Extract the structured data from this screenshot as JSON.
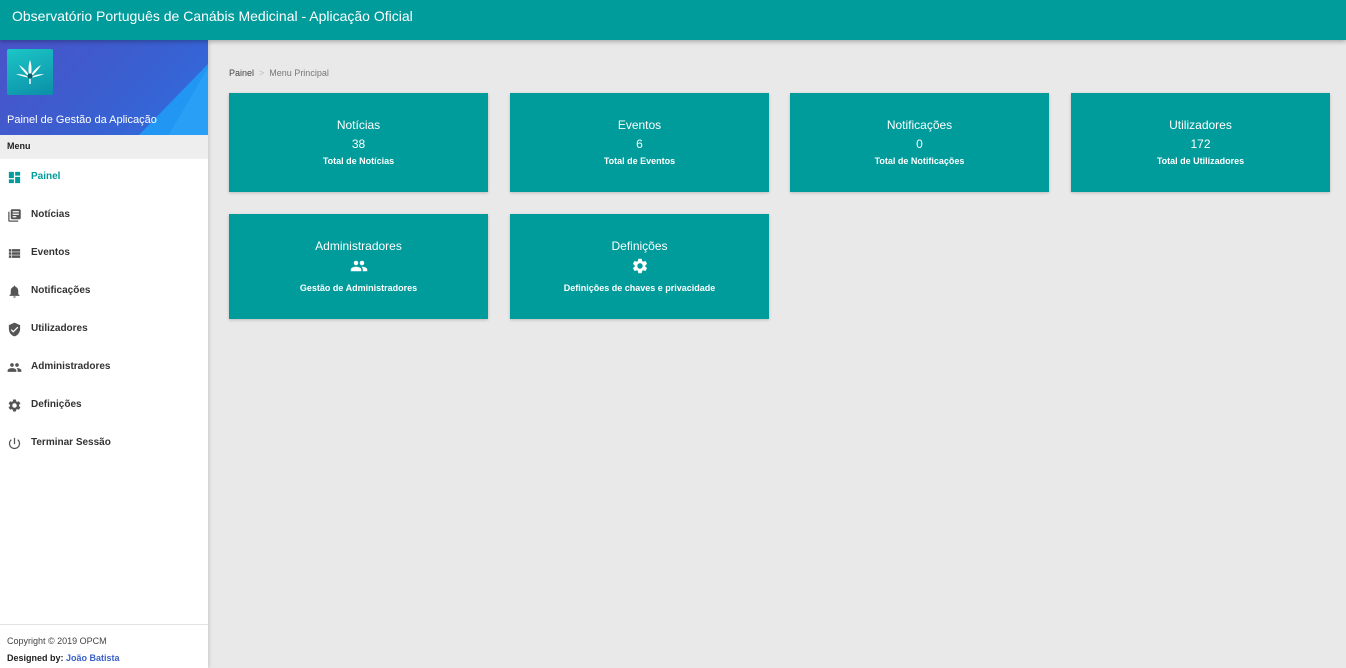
{
  "topbar": {
    "title": "Observatório Português de Canábis Medicinal - Aplicação Oficial"
  },
  "sidebar": {
    "logo_icon": "cannabis-leaf-logo",
    "panel_title": "Painel de Gestão da Aplicação",
    "menu_label": "Menu",
    "items": [
      {
        "label": "Painel",
        "icon": "dashboard-icon",
        "active": true
      },
      {
        "label": "Notícias",
        "icon": "newspaper-icon"
      },
      {
        "label": "Eventos",
        "icon": "list-icon"
      },
      {
        "label": "Notificações",
        "icon": "bell-icon"
      },
      {
        "label": "Utilizadores",
        "icon": "shield-check-icon"
      },
      {
        "label": "Administradores",
        "icon": "people-icon"
      },
      {
        "label": "Definições",
        "icon": "gear-icon"
      },
      {
        "label": "Terminar Sessão",
        "icon": "power-icon"
      }
    ],
    "footer": {
      "copyright": "Copyright © 2019 OPCM",
      "designed_by_label": "Designed by:",
      "designer": "João Batista"
    }
  },
  "breadcrumb": {
    "home": "Painel",
    "separator": ">",
    "current": "Menu Principal"
  },
  "cards": [
    {
      "title": "Notícias",
      "value": "38",
      "subtitle": "Total de Notícias"
    },
    {
      "title": "Eventos",
      "value": "6",
      "subtitle": "Total de Eventos"
    },
    {
      "title": "Notificações",
      "value": "0",
      "subtitle": "Total de Notificações"
    },
    {
      "title": "Utilizadores",
      "value": "172",
      "subtitle": "Total de Utilizadores"
    },
    {
      "title": "Administradores",
      "icon": "people-icon",
      "subtitle": "Gestão de Administradores"
    },
    {
      "title": "Definições",
      "icon": "gear-icon",
      "subtitle": "Definições de chaves e privacidade"
    }
  ],
  "colors": {
    "accent": "#009b9b",
    "sidebar_header": "#3a5fd0",
    "background": "#e9e9e9"
  }
}
